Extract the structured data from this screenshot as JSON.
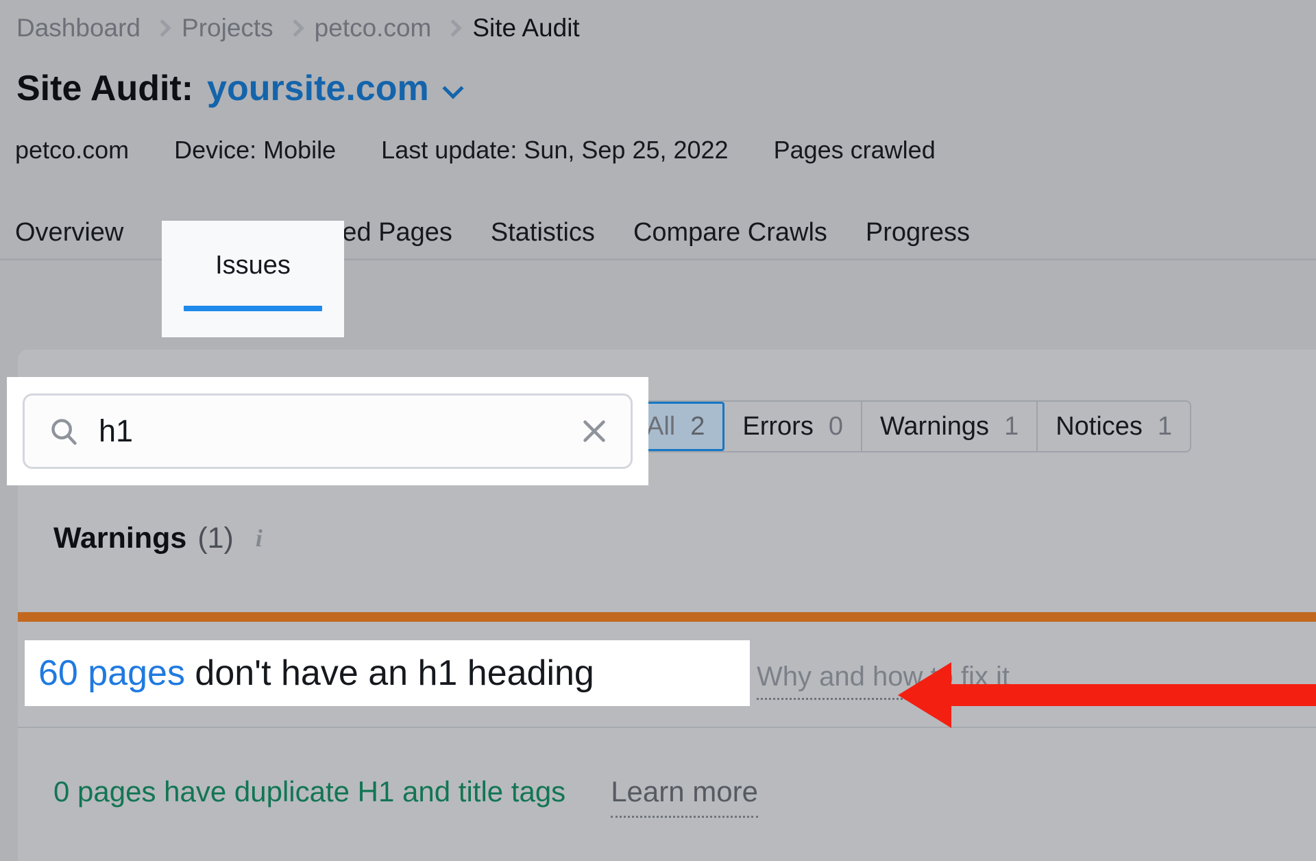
{
  "breadcrumb": {
    "items": [
      {
        "label": "Dashboard"
      },
      {
        "label": "Projects"
      },
      {
        "label": "petco.com"
      },
      {
        "label": "Site Audit"
      }
    ]
  },
  "header": {
    "title_static": "Site Audit:",
    "title_domain": "yoursite.com",
    "caret_icon": "chevron-down-icon"
  },
  "meta": {
    "domain": "petco.com",
    "device": "Device: Mobile",
    "last_update": "Last update: Sun, Sep 25, 2022",
    "pages_crawled": "Pages crawled"
  },
  "tabs": [
    {
      "label": "Overview",
      "active": false
    },
    {
      "label": "Issues",
      "active": true
    },
    {
      "label": "Crawled Pages",
      "active": false
    },
    {
      "label": "Statistics",
      "active": false
    },
    {
      "label": "Compare Crawls",
      "active": false
    },
    {
      "label": "Progress",
      "active": false
    }
  ],
  "search": {
    "value": "h1",
    "placeholder": "Search",
    "search_icon": "search-icon",
    "clear_icon": "close-icon"
  },
  "filters": [
    {
      "label": "All",
      "count": "2",
      "active": true
    },
    {
      "label": "Errors",
      "count": "0",
      "active": false
    },
    {
      "label": "Warnings",
      "count": "1",
      "active": false
    },
    {
      "label": "Notices",
      "count": "1",
      "active": false
    }
  ],
  "warnings_section": {
    "title": "Warnings",
    "count": "(1)",
    "info_icon": "info-icon",
    "severity_color": "#c2691f"
  },
  "issue": {
    "link_text": "60 pages",
    "rest_text": " don't have an h1 heading",
    "fix_it_label": "Why and how to fix it"
  },
  "notice": {
    "text": "0 pages have duplicate H1 and title tags",
    "learn_more": "Learn more"
  },
  "annotation": {
    "arrow_color": "#f32012",
    "arrow_direction": "left"
  },
  "colors": {
    "page_background": "#b0b2b6",
    "panel_background": "#b8babe",
    "accent_blue": "#1f7ae0",
    "link_blue": "#1464ab",
    "green": "#127553",
    "orange": "#c2691f",
    "highlight_white": "#ffffff"
  }
}
